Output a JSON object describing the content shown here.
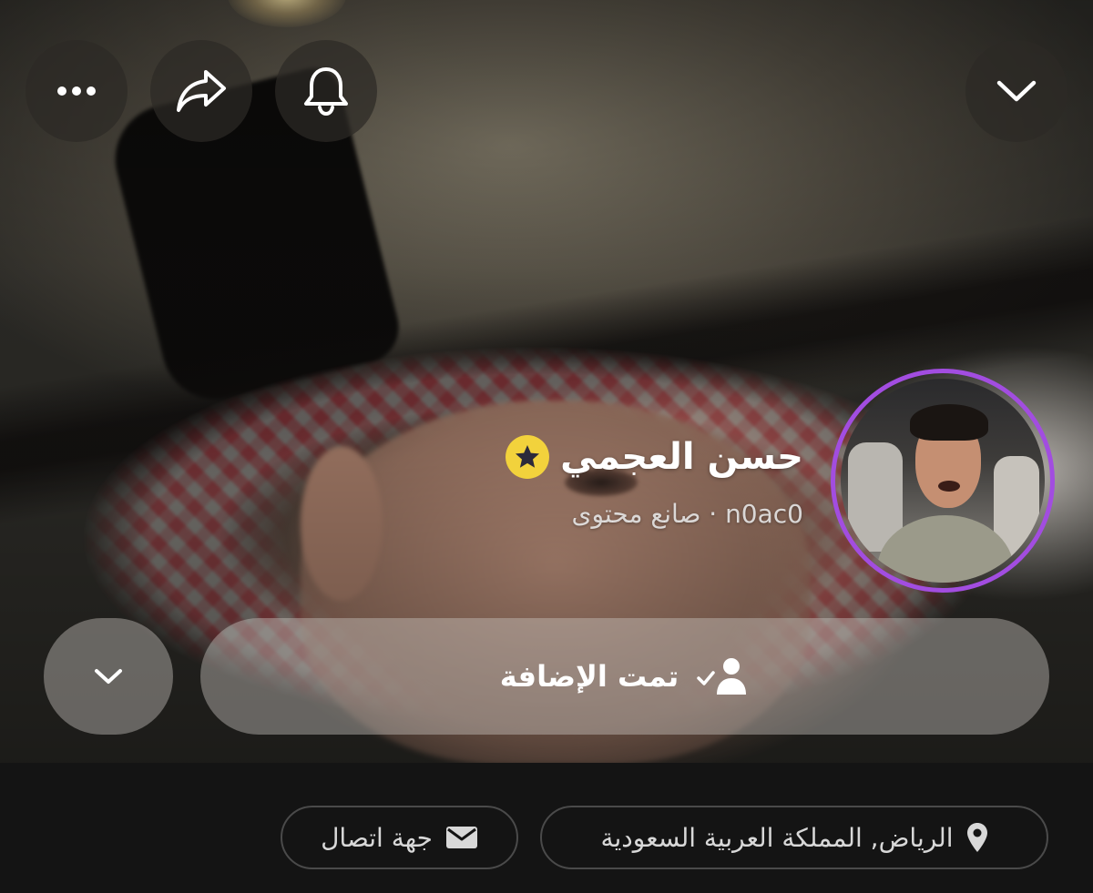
{
  "profile": {
    "display_name": "حسن العجمي",
    "username": "n0ac0",
    "subtitle": "n0ac0 · صانع محتوى",
    "role": "صانع محتوى",
    "avatar_ring_color": "#a24de0",
    "badge_icon": "star-icon",
    "badge_color": "#f2d23c"
  },
  "toolbar": {
    "more_icon": "ellipsis-icon",
    "share_icon": "share-arrow-icon",
    "notifications_icon": "bell-icon",
    "collapse_icon": "chevron-down-icon"
  },
  "actions": {
    "added_label": "تمت الإضافة",
    "added_icon": "user-check-icon",
    "more_actions_icon": "chevron-down-icon"
  },
  "info": {
    "location_label": "الرياض, المملكة العربية السعودية",
    "location_icon": "map-pin-icon",
    "contact_label": "جهة اتصال",
    "contact_icon": "envelope-icon"
  }
}
